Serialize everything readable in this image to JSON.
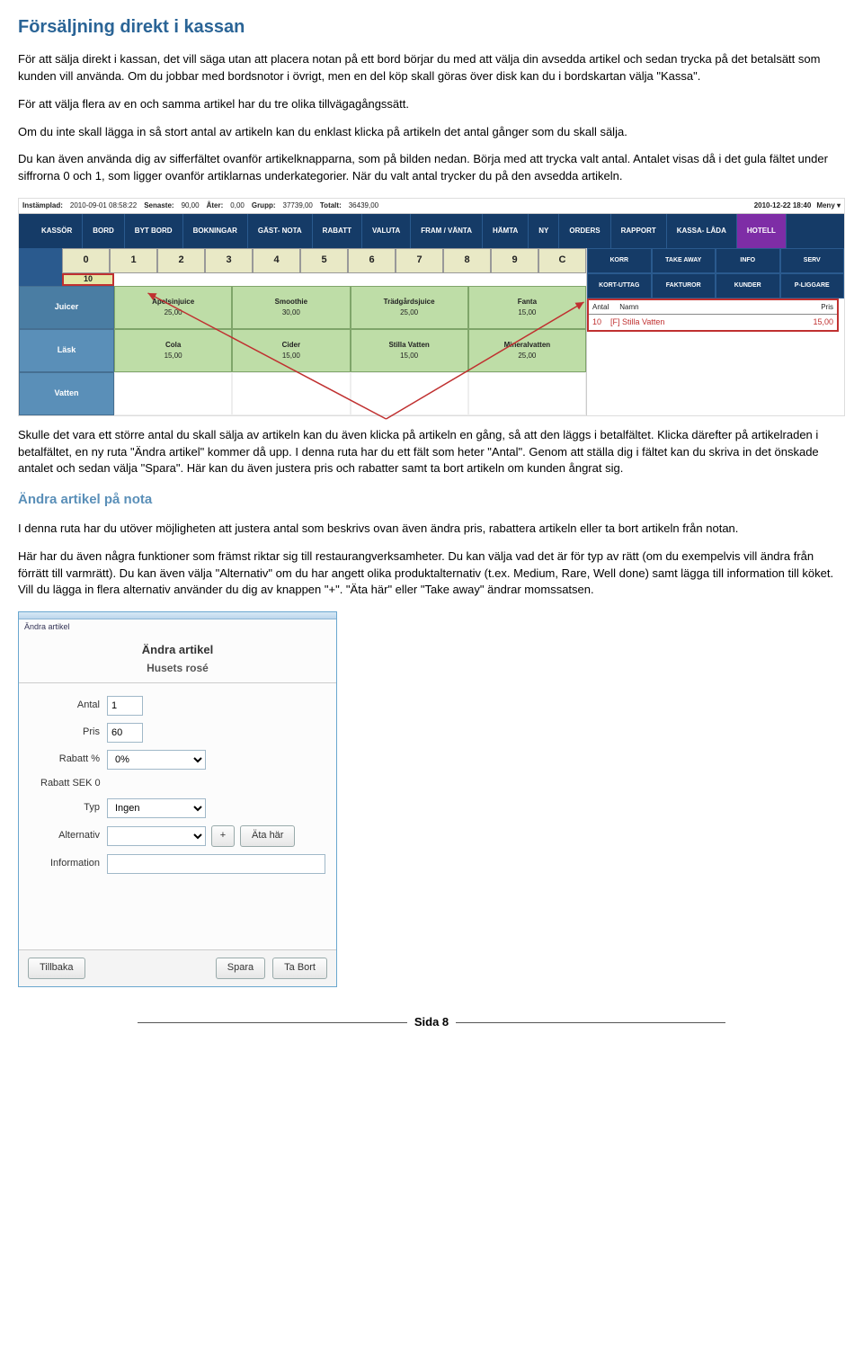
{
  "heading": "Försäljning direkt i kassan",
  "p1": "För att sälja direkt i kassan, det vill säga utan att placera notan på ett bord börjar du med att välja din avsedda artikel och sedan trycka på det betalsätt som kunden vill använda. Om du jobbar med bordsnotor i övrigt, men en del köp skall göras över disk kan du i bordskartan välja \"Kassa\".",
  "p2": "För att välja flera av en och samma artikel har du tre olika tillvägagångssätt.",
  "p3": "Om du inte skall lägga in så stort antal av artikeln kan du enklast klicka på artikeln det antal gånger som du skall sälja.",
  "p4": "Du kan även använda dig av sifferfältet ovanför artikelknapparna, som på bilden nedan. Börja med att trycka valt antal. Antalet visas då i det gula fältet under siffrorna 0 och 1, som ligger ovanför artiklarnas underkategorier. När du valt antal trycker du på den avsedda artikeln.",
  "p5": "Skulle det vara ett större antal du skall sälja av artikeln kan du även klicka på artikeln en gång, så att den läggs i betalfältet. Klicka därefter på artikelraden i betalfältet, en ny ruta \"Ändra artikel\" kommer då upp. I denna ruta har du ett fält som heter \"Antal\". Genom att ställa dig i fältet kan du skriva in det önskade antalet och sedan välja \"Spara\". Här kan du även justera pris och rabatter samt ta bort artikeln om kunden ångrat sig.",
  "sub1": "Ändra artikel på nota",
  "p6": "I denna ruta har du utöver möjligheten att justera antal som beskrivs ovan även ändra pris, rabattera artikeln eller ta bort artikeln från notan.",
  "p7": "Här har du även några funktioner som främst riktar sig till restaurangverksamheter. Du kan välja vad det är för typ av rätt (om du exempelvis vill ändra från förrätt till varmrätt). Du kan även välja \"Alternativ\" om du har angett olika produktalternativ (t.ex. Medium, Rare, Well done) samt lägga till information till köket.  Vill du lägga in flera alternativ använder du dig av knappen \"+\".  \"Äta här\" eller \"Take away\" ändrar momssatsen.",
  "pos": {
    "status": {
      "label1": "Instämplad:",
      "val1": "2010-09-01 08:58:22",
      "label2": "Senaste:",
      "val2": "90,00",
      "label3": "Åter:",
      "val3": "0,00",
      "label4": "Grupp:",
      "val4": "37739,00",
      "label5": "Totalt:",
      "val5": "36439,00",
      "right_time": "2010-12-22 18:40",
      "right_menu": "Meny ▾"
    },
    "nav": [
      "KASSÖR",
      "BORD",
      "BYT BORD",
      "BOKNINGAR",
      "GÄST-\nNOTA",
      "RABATT",
      "VALUTA",
      "FRAM /\nVÄNTA",
      "HÄMTA",
      "NY",
      "ORDERS",
      "RAPPORT",
      "KASSA-\nLÅDA",
      "HOTELL"
    ],
    "digits": [
      "0",
      "1",
      "2",
      "3",
      "4",
      "5",
      "6",
      "7",
      "8",
      "9",
      "C"
    ],
    "qty_display": "10",
    "cats": [
      "Juicer",
      "Läsk",
      "Vatten"
    ],
    "row1": [
      {
        "n": "Apelsinjuice",
        "p": "25,00"
      },
      {
        "n": "Smoothie",
        "p": "30,00"
      },
      {
        "n": "Trädgårdsjuice",
        "p": "25,00"
      },
      {
        "n": "Fanta",
        "p": "15,00"
      }
    ],
    "row2": [
      {
        "n": "Cola",
        "p": "15,00"
      },
      {
        "n": "Cider",
        "p": "15,00"
      },
      {
        "n": "Stilla Vatten",
        "p": "15,00"
      },
      {
        "n": "Mineralvatten",
        "p": "25,00"
      }
    ],
    "funcs_r1": [
      "KORR",
      "TAKE AWAY",
      "INFO",
      "SERV"
    ],
    "funcs_r2": [
      "KORT-UTTAG",
      "FAKTUROR",
      "KUNDER",
      "P-LIGGARE"
    ],
    "order_head": {
      "c1": "Antal",
      "c2": "Namn",
      "c3": "Pris"
    },
    "order_line": {
      "qty": "10",
      "name": "[F] Stilla Vatten",
      "price": "15,00"
    }
  },
  "dialog": {
    "win_title": "Ändra artikel",
    "title": "Ändra artikel",
    "subtitle": "Husets rosé",
    "antal_lbl": "Antal",
    "antal_val": "1",
    "pris_lbl": "Pris",
    "pris_val": "60",
    "rabp_lbl": "Rabatt %",
    "rabp_val": "0%",
    "rabk_lbl": "Rabatt SEK 0",
    "typ_lbl": "Typ",
    "typ_val": "Ingen",
    "alt_lbl": "Alternativ",
    "plus": "+",
    "atahar": "Äta här",
    "info_lbl": "Information",
    "btn_back": "Tillbaka",
    "btn_save": "Spara",
    "btn_del": "Ta Bort"
  },
  "footer": "Sida 8"
}
